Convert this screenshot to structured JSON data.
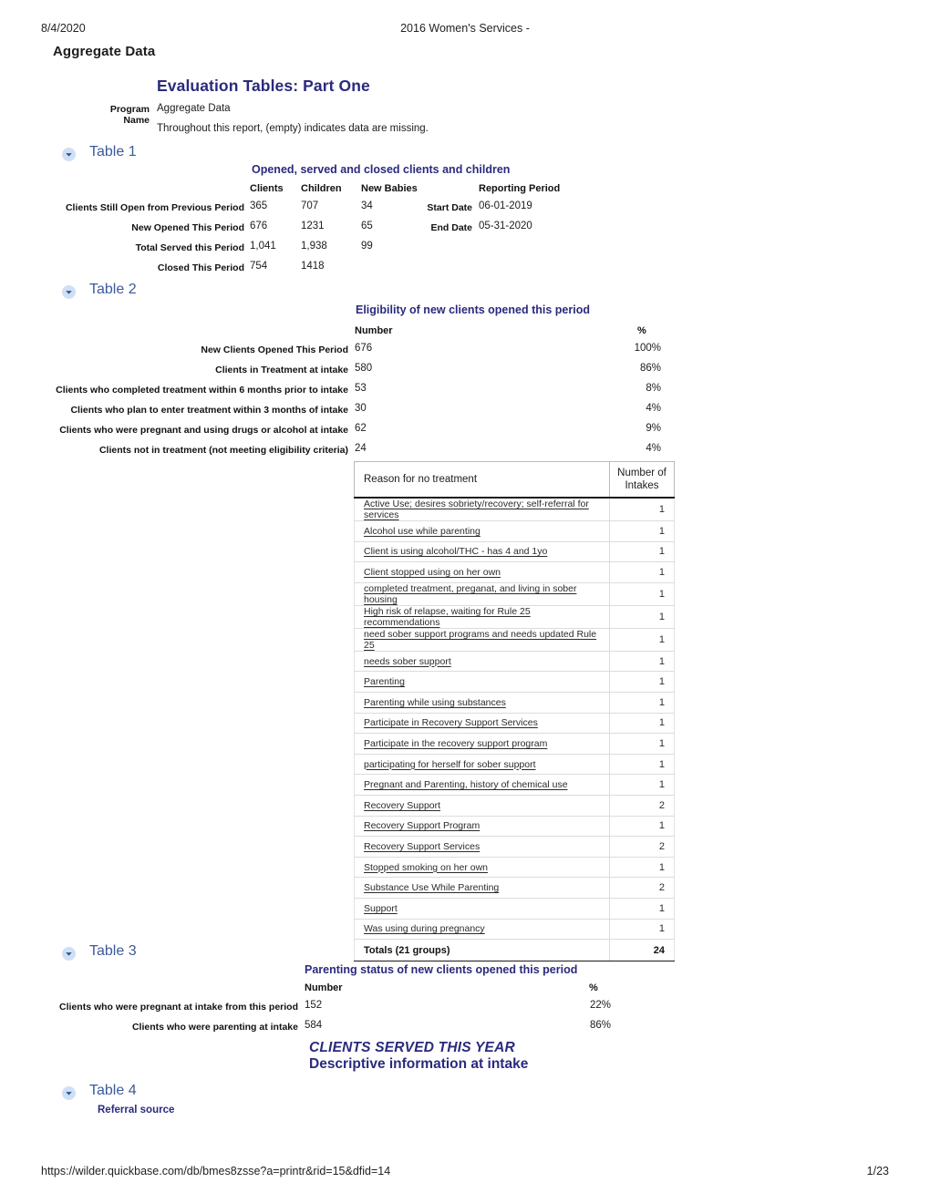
{
  "print_header": {
    "date": "8/4/2020",
    "title": "2016 Women's Services -"
  },
  "print_footer": {
    "url": "https://wilder.quickbase.com/db/bmes8zsse?a=printr&rid=15&dfid=14",
    "page": "1/23"
  },
  "app_title": "Aggregate Data",
  "doc_title": "Evaluation Tables: Part One",
  "meta": {
    "program_name_label": "Program Name",
    "program_name_value": "Aggregate Data",
    "note": "Throughout this report, (empty) indicates data are missing."
  },
  "sections": {
    "table1": "Table 1",
    "table2": "Table 2",
    "table3": "Table 3",
    "table4": "Table 4"
  },
  "table1": {
    "caption": "Opened, served and closed clients and children",
    "columns": [
      "Clients",
      "Children",
      "New Babies"
    ],
    "rows": [
      {
        "label": "Clients Still Open from Previous Period",
        "clients": "365",
        "children": "707",
        "babies": "34"
      },
      {
        "label": "New Opened This Period",
        "clients": "676",
        "children": "1231",
        "babies": "65"
      },
      {
        "label": "Total Served this Period",
        "clients": "1,041",
        "children": "1,938",
        "babies": "99"
      },
      {
        "label": "Closed This Period",
        "clients": "754",
        "children": "1418",
        "babies": ""
      }
    ],
    "reporting_period": {
      "header": "Reporting Period",
      "start_label": "Start Date",
      "start_value": "06-01-2019",
      "end_label": "End Date",
      "end_value": "05-31-2020"
    }
  },
  "table2": {
    "caption": "Eligibility of new clients opened this period",
    "columns": [
      "Number",
      "%"
    ],
    "rows": [
      {
        "label": "New Clients Opened This Period",
        "number": "676",
        "pct": "100%"
      },
      {
        "label": "Clients in Treatment at intake",
        "number": "580",
        "pct": "86%"
      },
      {
        "label": "Clients who completed treatment within 6 months prior to intake",
        "number": "53",
        "pct": "8%"
      },
      {
        "label": "Clients who plan to enter treatment within 3 months of intake",
        "number": "30",
        "pct": "4%"
      },
      {
        "label": "Clients who were pregnant and using drugs or alcohol at intake",
        "number": "62",
        "pct": "9%"
      },
      {
        "label": "Clients not in treatment (not meeting eligibility criteria)",
        "number": "24",
        "pct": "4%"
      }
    ]
  },
  "reason_table": {
    "headers": [
      "Reason for no treatment",
      "Number of Intakes"
    ],
    "header_col2_line1": "Number of",
    "header_col2_line2": "Intakes",
    "rows": [
      {
        "reason": "Active Use; desires sobriety/recovery; self-referral for services",
        "intakes": "1"
      },
      {
        "reason": "Alcohol use while parenting",
        "intakes": "1"
      },
      {
        "reason": "Client is using alcohol/THC - has 4 and  1yo",
        "intakes": "1"
      },
      {
        "reason": "Client stopped using on her own",
        "intakes": "1"
      },
      {
        "reason": "completed treatment, preganat, and living in sober housing",
        "intakes": "1"
      },
      {
        "reason": "High risk of relapse, waiting for Rule 25 recommendations",
        "intakes": "1"
      },
      {
        "reason": "need sober support programs and needs updated Rule 25",
        "intakes": "1"
      },
      {
        "reason": "needs sober support",
        "intakes": "1"
      },
      {
        "reason": "Parenting",
        "intakes": "1"
      },
      {
        "reason": "Parenting while using substances",
        "intakes": "1"
      },
      {
        "reason": "Participate in Recovery Support Services",
        "intakes": "1"
      },
      {
        "reason": "Participate in the recovery support program",
        "intakes": "1"
      },
      {
        "reason": "participating for herself for sober support",
        "intakes": "1"
      },
      {
        "reason": "Pregnant and Parenting, history of chemical use",
        "intakes": "1"
      },
      {
        "reason": "Recovery Support",
        "intakes": "2"
      },
      {
        "reason": "Recovery Support Program",
        "intakes": "1"
      },
      {
        "reason": "Recovery Support Services",
        "intakes": "2"
      },
      {
        "reason": "Stopped smoking on her own",
        "intakes": "1"
      },
      {
        "reason": "Substance Use While Parenting",
        "intakes": "2"
      },
      {
        "reason": "Support",
        "intakes": "1"
      },
      {
        "reason": "Was using during pregnancy",
        "intakes": "1"
      }
    ],
    "totals": {
      "label": "Totals (21 groups)",
      "value": "24"
    }
  },
  "table3": {
    "caption": "Parenting status of new clients opened this period",
    "columns": [
      "Number",
      "%"
    ],
    "rows": [
      {
        "label": "Clients who were pregnant at intake from this period",
        "number": "152",
        "pct": "22%"
      },
      {
        "label": "Clients who were parenting at intake",
        "number": "584",
        "pct": "86%"
      }
    ]
  },
  "banner": {
    "line1": "CLIENTS SERVED THIS YEAR",
    "line2": "Descriptive information at intake"
  },
  "table4": {
    "caption": "Referral source"
  },
  "colors": {
    "heading_navy": "#2a2a7e",
    "section_blue": "#3b5a9a",
    "disclosure_bg": "#cfe0f5"
  }
}
